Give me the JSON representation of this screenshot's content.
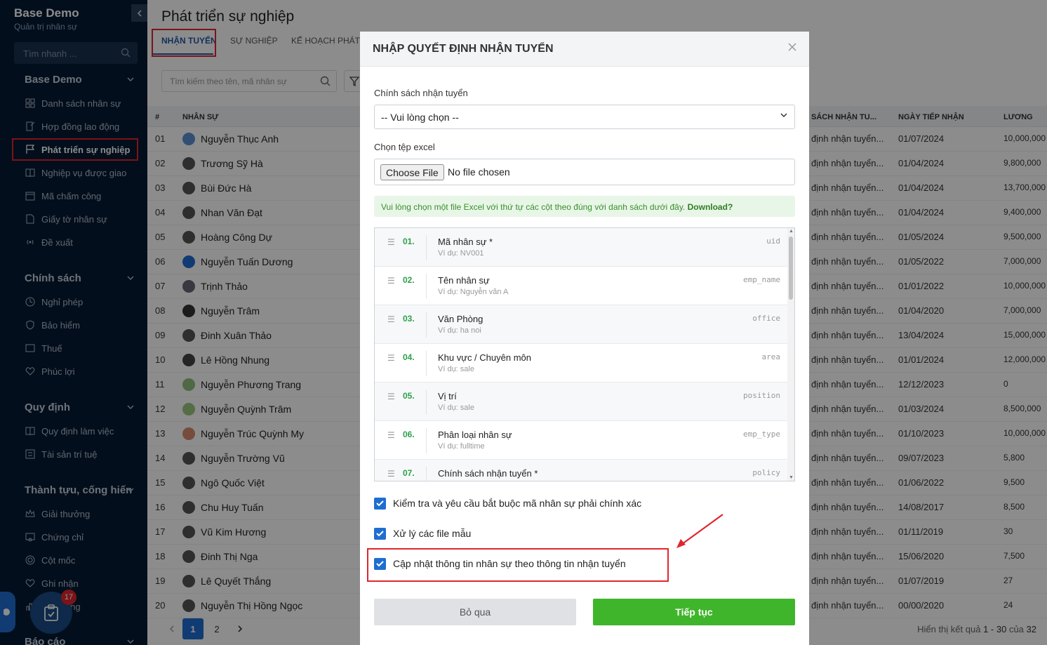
{
  "sidebar": {
    "brand_name": "Base Demo",
    "brand_sub": "Quản trị nhân sự",
    "search_placeholder": "Tìm nhanh ...",
    "sections": [
      {
        "title": "Base Demo",
        "items": [
          "Danh sách nhân sự",
          "Hợp đồng lao động",
          "Phát triển sự nghiệp",
          "Nghiệp vụ được giao",
          "Mã chấm công",
          "Giấy tờ nhân sự",
          "Đề xuất"
        ]
      },
      {
        "title": "Chính sách",
        "items": [
          "Nghỉ phép",
          "Bảo hiểm",
          "Thuế",
          "Phúc lợi"
        ]
      },
      {
        "title": "Quy định",
        "items": [
          "Quy định làm việc",
          "Tài sản trí tuệ"
        ]
      },
      {
        "title": "Thành tựu, cống hiến",
        "items": [
          "Giải thưởng",
          "Chứng chỉ",
          "Cột mốc",
          "Ghi nhận",
          "Xếp hạng"
        ]
      },
      {
        "title": "Báo cáo",
        "items": []
      }
    ],
    "active_item": "Phát triển sự nghiệp"
  },
  "main": {
    "page_title": "Phát triển sự nghiệp",
    "tabs": [
      "NHẬN TUYỂN",
      "SỰ NGHIỆP",
      "KẾ HOẠCH PHÁT"
    ],
    "search_placeholder": "Tìm kiếm theo tên, mã nhân sự",
    "columns": {
      "idx": "#",
      "name": "NHÂN SỰ",
      "policy": "SÁCH NHẬN TU...",
      "date": "NGÀY TIẾP NHẬN",
      "salary": "LƯƠNG"
    },
    "rows": [
      {
        "idx": "01",
        "name": "Nguyễn Thục Anh",
        "policy": "định nhận tuyển...",
        "date": "01/07/2024",
        "salary": "10,000,000"
      },
      {
        "idx": "02",
        "name": "Trương Sỹ Hà",
        "policy": "định nhận tuyển...",
        "date": "01/04/2024",
        "salary": "9,800,000"
      },
      {
        "idx": "03",
        "name": "Bùi Đức Hà",
        "policy": "định nhận tuyển...",
        "date": "01/04/2024",
        "salary": "13,700,000"
      },
      {
        "idx": "04",
        "name": "Nhan Văn Đạt",
        "policy": "định nhận tuyển...",
        "date": "01/04/2024",
        "salary": "9,400,000"
      },
      {
        "idx": "05",
        "name": "Hoàng Công Dự",
        "policy": "định nhận tuyển...",
        "date": "01/05/2024",
        "salary": "9,500,000"
      },
      {
        "idx": "06",
        "name": "Nguyễn Tuấn Dương",
        "policy": "định nhận tuyển...",
        "date": "01/05/2022",
        "salary": "7,000,000"
      },
      {
        "idx": "07",
        "name": "Trịnh Thảo",
        "policy": "định nhận tuyển...",
        "date": "01/01/2022",
        "salary": "10,000,000"
      },
      {
        "idx": "08",
        "name": "Nguyễn Trâm",
        "policy": "định nhận tuyển...",
        "date": "01/04/2020",
        "salary": "7,000,000"
      },
      {
        "idx": "09",
        "name": "Đinh Xuân Thảo",
        "policy": "định nhận tuyển...",
        "date": "13/04/2024",
        "salary": "15,000,000"
      },
      {
        "idx": "10",
        "name": "Lê Hồng Nhung",
        "policy": "định nhận tuyển...",
        "date": "01/01/2024",
        "salary": "12,000,000"
      },
      {
        "idx": "11",
        "name": "Nguyễn Phương Trang",
        "policy": "định nhận tuyển...",
        "date": "12/12/2023",
        "salary": "0"
      },
      {
        "idx": "12",
        "name": "Nguyễn Quỳnh Trâm",
        "policy": "định nhận tuyển...",
        "date": "01/03/2024",
        "salary": "8,500,000"
      },
      {
        "idx": "13",
        "name": "Nguyễn Trúc Quỳnh My",
        "policy": "định nhận tuyển...",
        "date": "01/10/2023",
        "salary": "10,000,000"
      },
      {
        "idx": "14",
        "name": "Nguyễn Trường Vũ",
        "policy": "định nhận tuyển...",
        "date": "09/07/2023",
        "salary": "5,800"
      },
      {
        "idx": "15",
        "name": "Ngô Quốc Việt",
        "policy": "định nhận tuyển...",
        "date": "01/06/2022",
        "salary": "9,500"
      },
      {
        "idx": "16",
        "name": "Chu Huy Tuấn",
        "policy": "định nhận tuyển...",
        "date": "14/08/2017",
        "salary": "8,500"
      },
      {
        "idx": "17",
        "name": "Vũ Kim Hương",
        "policy": "định nhận tuyển...",
        "date": "01/11/2019",
        "salary": "30"
      },
      {
        "idx": "18",
        "name": "Đinh Thị Nga",
        "policy": "định nhận tuyển...",
        "date": "15/06/2020",
        "salary": "7,500"
      },
      {
        "idx": "19",
        "name": "Lê Quyết Thắng",
        "policy": "định nhận tuyển...",
        "date": "01/07/2019",
        "salary": "27"
      },
      {
        "idx": "20",
        "name": "Nguyễn Thị Hồng Ngọc",
        "policy": "định nhận tuyển...",
        "date": "00/00/2020",
        "salary": "24"
      }
    ],
    "pager": {
      "current": "1",
      "next_page": "2"
    },
    "result_prefix": "Hiển thị kết quả",
    "result_range": "1 - 30",
    "result_of": "của",
    "result_total": "32"
  },
  "modal": {
    "title": "NHẬP QUYẾT ĐỊNH NHẬN TUYỂN",
    "policy_label": "Chính sách nhận tuyển",
    "policy_value": "-- Vui lòng chọn --",
    "file_label": "Chọn tệp excel",
    "file_button": "Choose File",
    "file_status": "No file chosen",
    "notice": "Vui lòng chọn một file Excel với thứ tự các cột theo đúng với danh sách dưới đây.",
    "notice_link": "Download?",
    "fields": [
      {
        "num": "01.",
        "title": "Mã nhân sự *",
        "example": "Ví dụ: NV001",
        "key": "uid"
      },
      {
        "num": "02.",
        "title": "Tên nhân sự",
        "example": "Ví dụ: Nguyễn văn A",
        "key": "emp_name"
      },
      {
        "num": "03.",
        "title": "Văn Phòng",
        "example": "Ví dụ: ha noi",
        "key": "office"
      },
      {
        "num": "04.",
        "title": "Khu vực / Chuyên môn",
        "example": "Ví dụ: sale",
        "key": "area"
      },
      {
        "num": "05.",
        "title": "Vị trí",
        "example": "Ví dụ: sale",
        "key": "position"
      },
      {
        "num": "06.",
        "title": "Phân loại nhân sự",
        "example": "Ví dụ: fulltime",
        "key": "emp_type"
      },
      {
        "num": "07.",
        "title": "Chính sách nhận tuyển *",
        "example": "",
        "key": "policy"
      }
    ],
    "checkboxes": [
      {
        "label": "Kiểm tra và yêu cầu bắt buộc mã nhân sự phải chính xác",
        "checked": true
      },
      {
        "label": "Xử lý các file mẫu",
        "checked": true
      },
      {
        "label": "Cập nhật thông tin nhân sự theo thông tin nhận tuyển",
        "checked": true
      }
    ],
    "skip_label": "Bỏ qua",
    "next_label": "Tiếp tục"
  },
  "floating": {
    "badge_count": "17"
  },
  "colors": {
    "sidebar_bg": "#061a33",
    "accent_blue": "#1e6ed1",
    "primary_green": "#3fb52b",
    "highlight_red": "#e0262d"
  }
}
